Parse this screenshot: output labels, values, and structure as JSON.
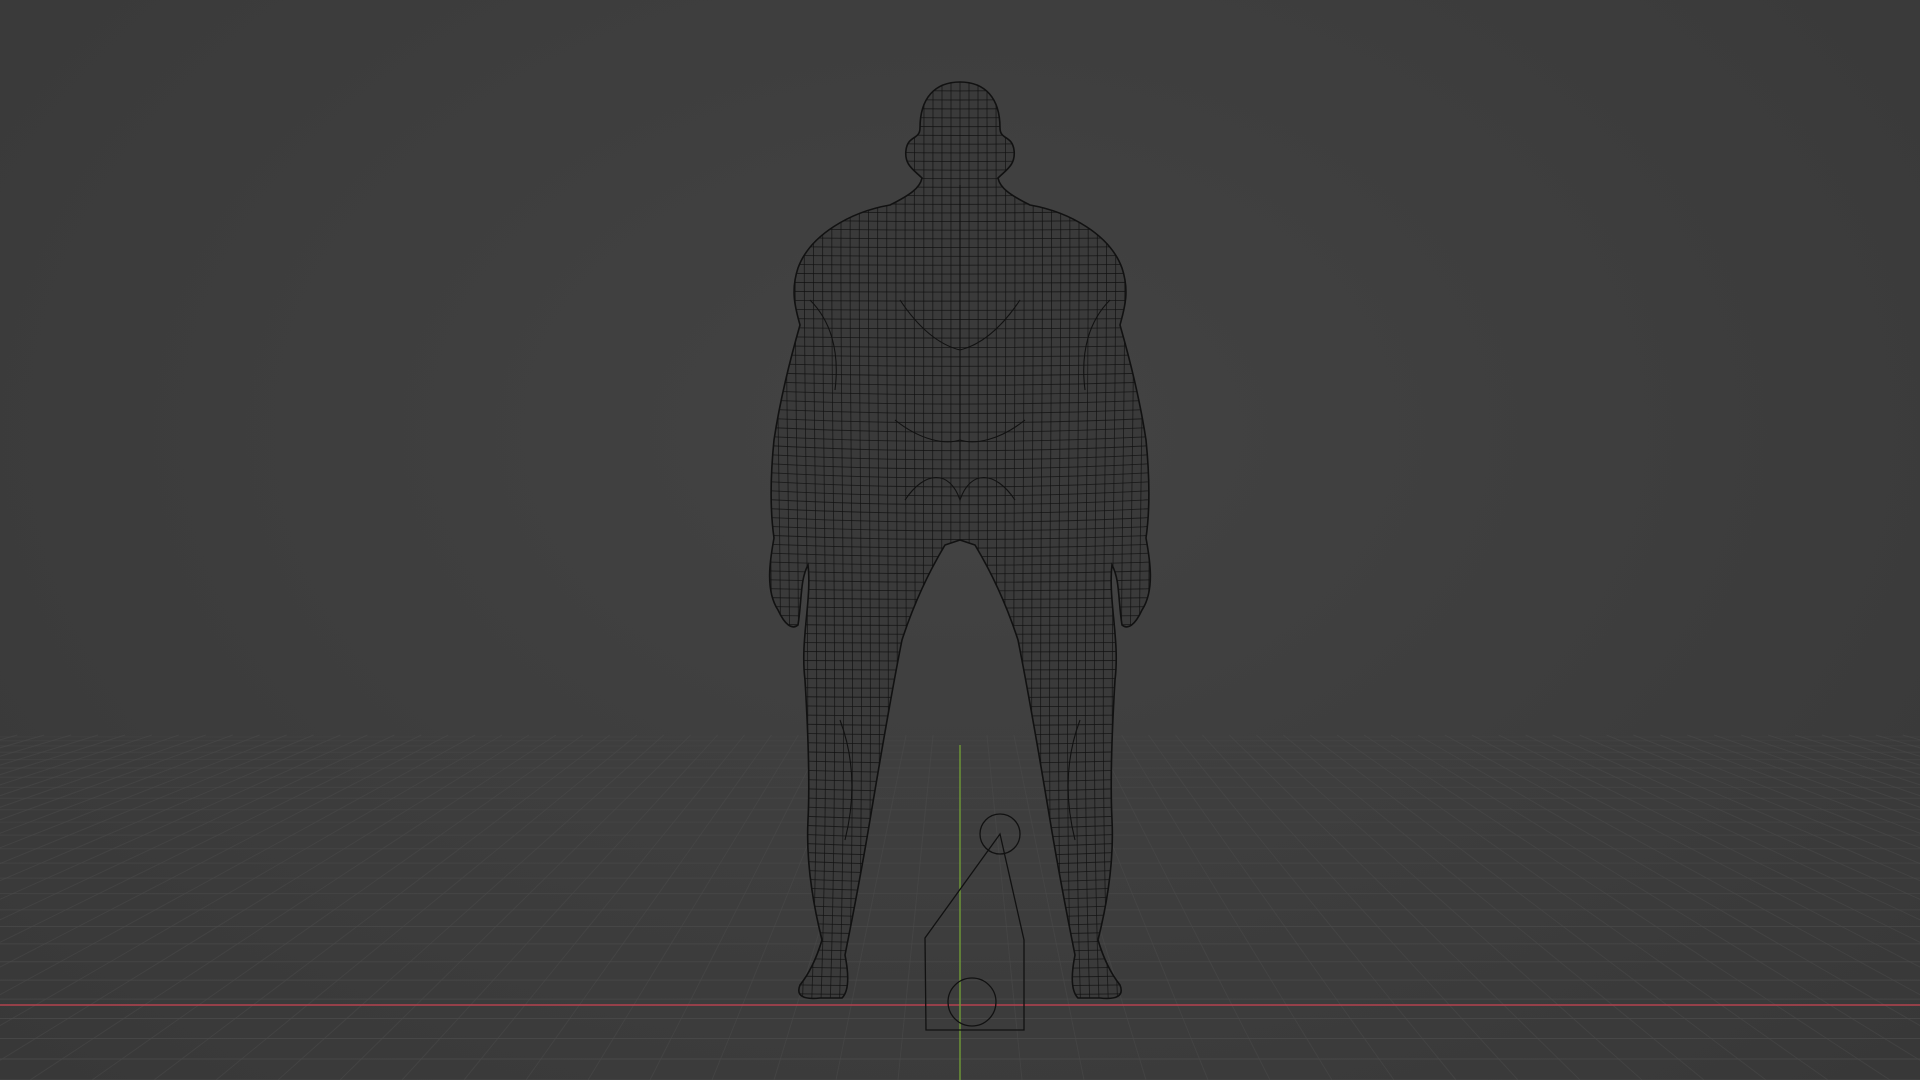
{
  "viewport": {
    "view": "back-orthographic-perspective",
    "shading": "wireframe",
    "background_color": "#3d3d3d",
    "grid_color": "#4a4a4a",
    "x_axis_color": "#b3424e",
    "y_axis_color": "#6f9a36",
    "wire_color": "#111111"
  },
  "scene_objects": [
    {
      "name": "character-mesh",
      "icon": "mesh-icon"
    },
    {
      "name": "armature-gizmo",
      "icon": "bone-icon"
    }
  ]
}
